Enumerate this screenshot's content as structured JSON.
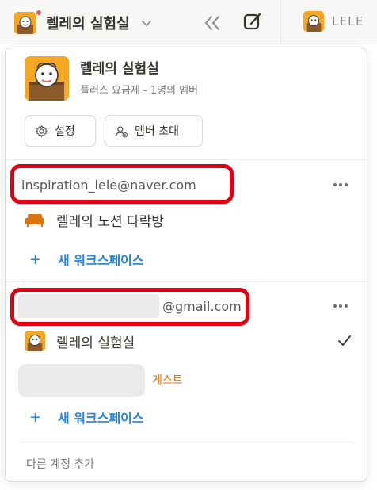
{
  "topbar": {
    "workspace_name": "렐레의 실험실",
    "tab_label": "LELE"
  },
  "panel": {
    "workspace_title": "렐레의 실험실",
    "workspace_subtitle": "플러스 요금제 - 1명의 멤버",
    "settings_label": "설정",
    "invite_label": "멤버 초대",
    "accounts": [
      {
        "email": "inspiration_lele@naver.com",
        "workspaces": [
          {
            "name": "렐레의 노션 다락방",
            "icon": "sofa-icon"
          }
        ],
        "add_workspace_label": "새 워크스페이스"
      },
      {
        "email": "@gmail.com",
        "workspaces": [
          {
            "name": "렐레의 실험실",
            "icon": "workspace-avatar",
            "selected": true
          },
          {
            "name": "",
            "badge": "게스트"
          }
        ],
        "add_workspace_label": "새 워크스페이스"
      }
    ],
    "add_account_label": "다른 계정 추가"
  },
  "colors": {
    "accent_blue": "#2383e2",
    "guest_orange": "#d9730d",
    "highlight_red": "#e00012",
    "avatar_orange": "#f5a623"
  }
}
